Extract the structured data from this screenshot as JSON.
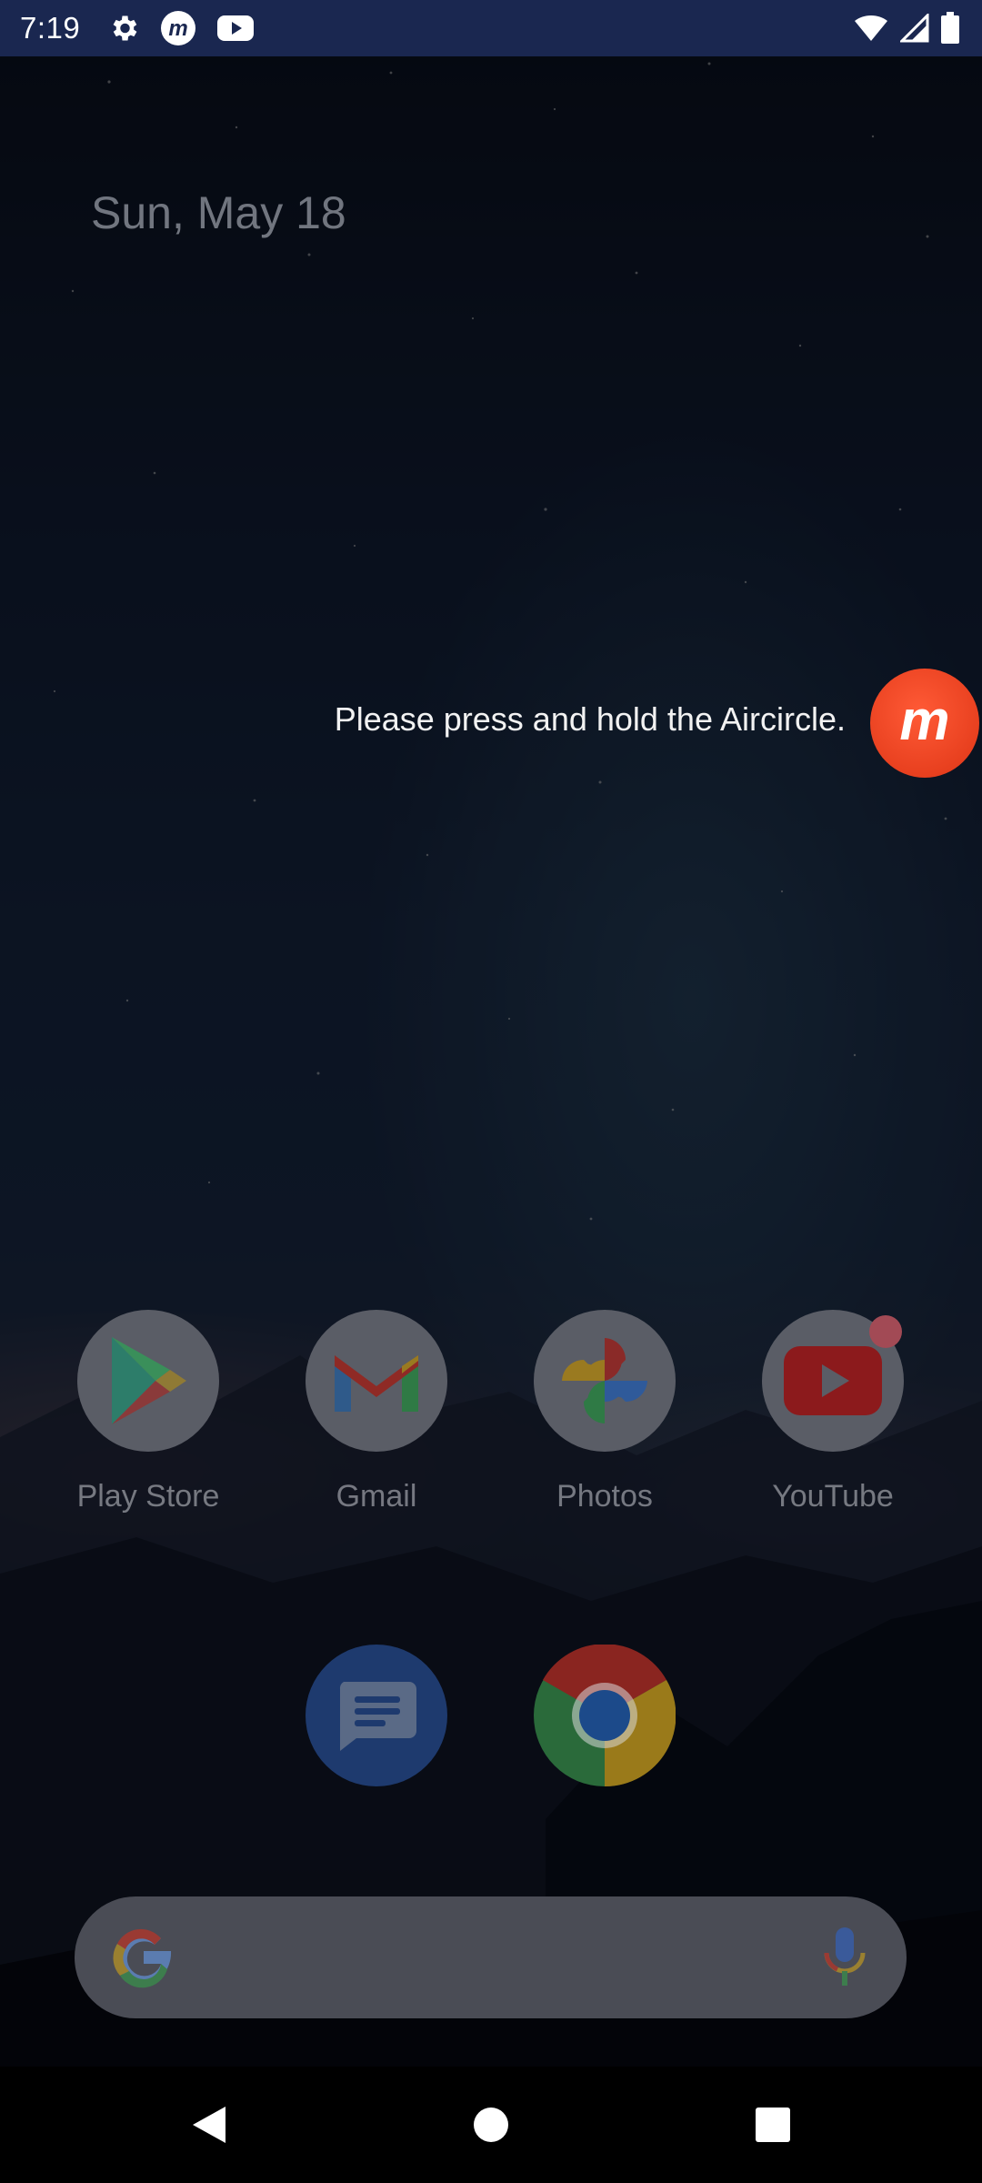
{
  "status_bar": {
    "time": "7:19",
    "left_icons": [
      "gear-icon",
      "mobizen-icon",
      "youtube-icon"
    ],
    "right_icons": [
      "wifi-icon",
      "signal-icon",
      "battery-icon"
    ]
  },
  "home": {
    "date": "Sun, May 18",
    "hint_text": "Please press and hold the Aircircle.",
    "aircircle_icon": "mobizen-aircircle-icon",
    "apps_row1": [
      {
        "label": "Play Store",
        "icon": "play-store-icon"
      },
      {
        "label": "Gmail",
        "icon": "gmail-icon"
      },
      {
        "label": "Photos",
        "icon": "photos-icon"
      },
      {
        "label": "YouTube",
        "icon": "youtube-icon",
        "notification_badge": true
      }
    ],
    "apps_row2": [
      {
        "icon": "messages-icon"
      },
      {
        "icon": "chrome-icon"
      }
    ]
  },
  "search": {
    "google_icon": "google-g-icon",
    "mic_icon": "mic-icon"
  },
  "navigation": {
    "back": "back-icon",
    "home": "home-icon",
    "recents": "recents-icon"
  },
  "colors": {
    "aircircle": "#e8401f",
    "status_bar": "#1a2750"
  }
}
